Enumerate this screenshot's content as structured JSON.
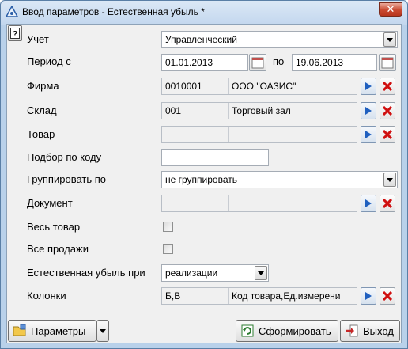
{
  "window": {
    "title": "Ввод параметров - Естественная убыль *",
    "close_label": "✕"
  },
  "help": {
    "label": "?"
  },
  "form": {
    "uchet": {
      "label": "Учет",
      "value": "Управленческий"
    },
    "period": {
      "label": "Период с",
      "from": "01.01.2013",
      "to_label": "по",
      "to": "19.06.2013"
    },
    "firma": {
      "label": "Фирма",
      "code": "0010001",
      "name": "ООО \"ОАЗИС\""
    },
    "sklad": {
      "label": "Склад",
      "code": "001",
      "name": "Торговый зал"
    },
    "tovar": {
      "label": "Товар",
      "code": "",
      "name": ""
    },
    "podbor": {
      "label": "Подбор по коду",
      "value": ""
    },
    "group": {
      "label": "Группировать по",
      "value": "не группировать"
    },
    "document": {
      "label": "Документ",
      "code": "",
      "name": ""
    },
    "ves_tovar": {
      "label": "Весь товар",
      "checked": false
    },
    "vse_prodazhi": {
      "label": "Все продажи",
      "checked": false
    },
    "ubyl": {
      "label": "Естественная убыль при",
      "value": "реализации"
    },
    "kolonki": {
      "label": "Колонки",
      "code": "Б,В",
      "name": "Код товара,Ед.измерени"
    }
  },
  "buttons": {
    "params": "Параметры",
    "generate": "Сформировать",
    "exit": "Выход"
  },
  "colors": {
    "window_frame": "#b9d1ea",
    "client_bg": "#f0f0f0",
    "close_red": "#c94a31",
    "select_arrow_blue": "#1f5fbf",
    "clear_x_red": "#d01010"
  }
}
